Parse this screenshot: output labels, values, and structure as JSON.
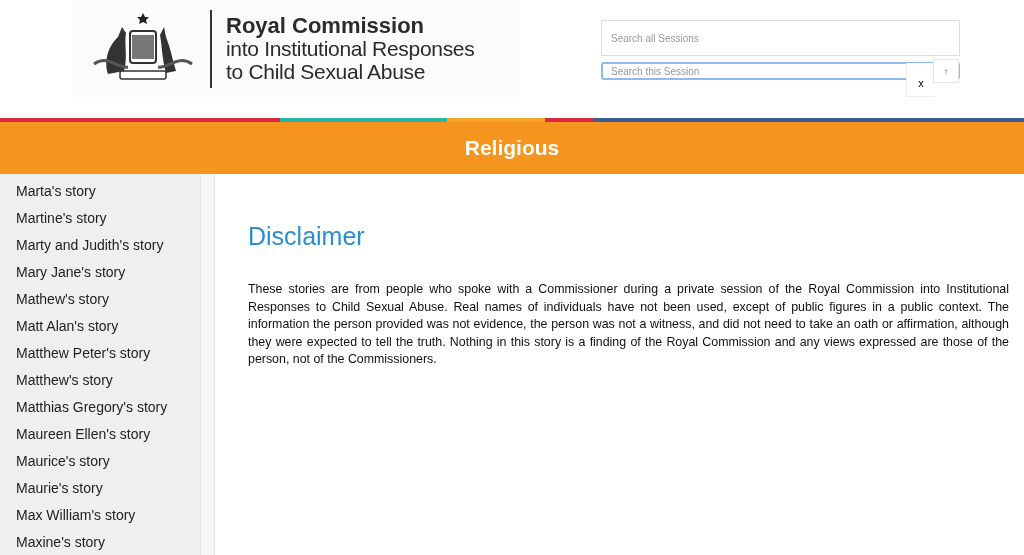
{
  "logo": {
    "title": "Royal Commission",
    "subtitle_lines": [
      "into Institutional Responses",
      "to Child Sexual Abuse"
    ]
  },
  "search": {
    "all_sessions": {
      "placeholder": "Search all Sessions"
    },
    "this_session": {
      "placeholder": "Search this Session"
    },
    "clear_button": "x",
    "up_button": "↑"
  },
  "stripe": [
    {
      "color": "#d9283c"
    },
    {
      "color": "#2bb5a0"
    },
    {
      "color": "#f3a52c"
    },
    {
      "color": "#d9283c"
    },
    {
      "color": "#3b5f93"
    }
  ],
  "banner": {
    "title": "Religious"
  },
  "sidebar": {
    "items": [
      {
        "label": "Marta's story"
      },
      {
        "label": "Martine's story"
      },
      {
        "label": "Marty and Judith's story"
      },
      {
        "label": "Mary Jane's story"
      },
      {
        "label": "Mathew's story"
      },
      {
        "label": "Matt Alan's story"
      },
      {
        "label": "Matthew Peter's story"
      },
      {
        "label": "Matthew's story"
      },
      {
        "label": "Matthias Gregory's story"
      },
      {
        "label": "Maureen Ellen's story"
      },
      {
        "label": "Maurice's story"
      },
      {
        "label": "Maurie's story"
      },
      {
        "label": "Max William's story"
      },
      {
        "label": "Maxine's story"
      }
    ]
  },
  "content": {
    "heading": "Disclaimer",
    "paragraph": "These stories are from people who spoke with a Commissioner during a private session of the Royal Commission into Institutional Responses to Child Sexual Abuse. Real names of individuals have not been used, except of public figures in a public context. The information the person provided was not evidence, the person was not a witness, and did not need to take an oath or affirmation, although they were expected to tell the truth. Nothing in this story is a finding of the Royal Commission and any views expressed are those of the person, not of the Commissioners."
  }
}
